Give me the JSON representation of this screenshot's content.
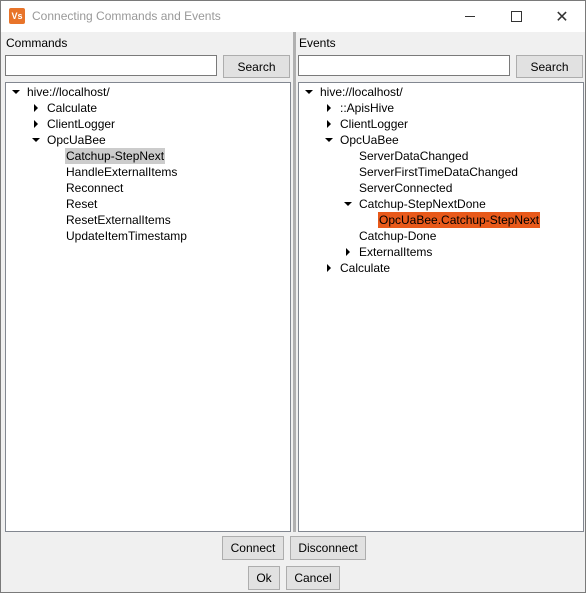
{
  "window": {
    "title": "Connecting Commands and Events",
    "app_icon_text": "Vs"
  },
  "commands": {
    "header": "Commands",
    "search_value": "",
    "search_button": "Search",
    "tree": {
      "root": "hive://localhost/",
      "items": [
        "Calculate",
        "ClientLogger",
        "OpcUaBee"
      ],
      "opcuabee_children": [
        "Catchup-StepNext",
        "HandleExternalItems",
        "Reconnect",
        "Reset",
        "ResetExternalItems",
        "UpdateItemTimestamp"
      ]
    }
  },
  "events": {
    "header": "Events",
    "search_value": "",
    "search_button": "Search",
    "tree": {
      "root": "hive://localhost/",
      "items": [
        "::ApisHive",
        "ClientLogger",
        "OpcUaBee",
        "Calculate"
      ],
      "opcuabee_children": [
        "ServerDataChanged",
        "ServerFirstTimeDataChanged",
        "ServerConnected",
        "Catchup-StepNextDone",
        "Catchup-Done",
        "ExternalItems"
      ],
      "stepnextdone_children": [
        "OpcUaBee.Catchup-StepNext"
      ]
    }
  },
  "buttons": {
    "connect": "Connect",
    "disconnect": "Disconnect",
    "ok": "Ok",
    "cancel": "Cancel"
  },
  "colors": {
    "selection_gray": "#cccccc",
    "selection_orange": "#e8591a",
    "accent": "#e8742a"
  }
}
